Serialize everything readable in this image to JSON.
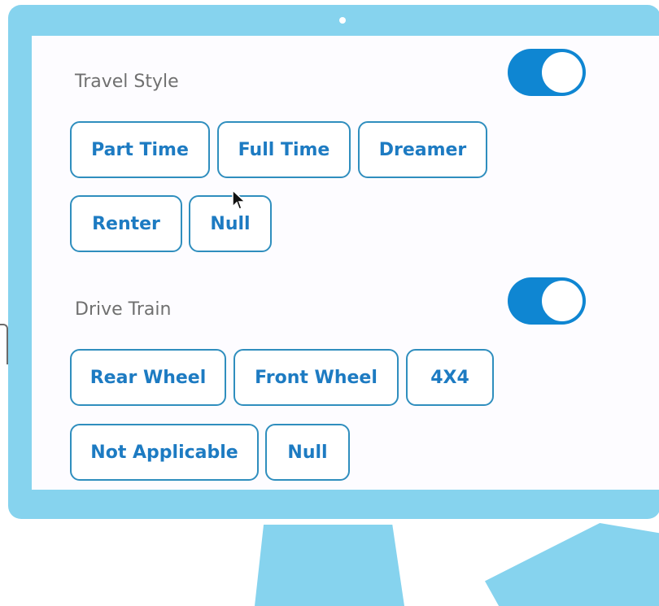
{
  "sections": [
    {
      "title": "Travel Style",
      "toggle_on": true,
      "options": [
        "Part Time",
        "Full Time",
        "Dreamer",
        "Renter",
        "Null"
      ]
    },
    {
      "title": "Drive Train",
      "toggle_on": true,
      "options": [
        "Rear Wheel",
        "Front Wheel",
        "4X4",
        "Not Applicable",
        "Null"
      ]
    }
  ],
  "colors": {
    "frame": "#86d3ee",
    "accent": "#0f86d2",
    "chip_text": "#1d7bc2",
    "chip_border": "#2f8ebe"
  }
}
